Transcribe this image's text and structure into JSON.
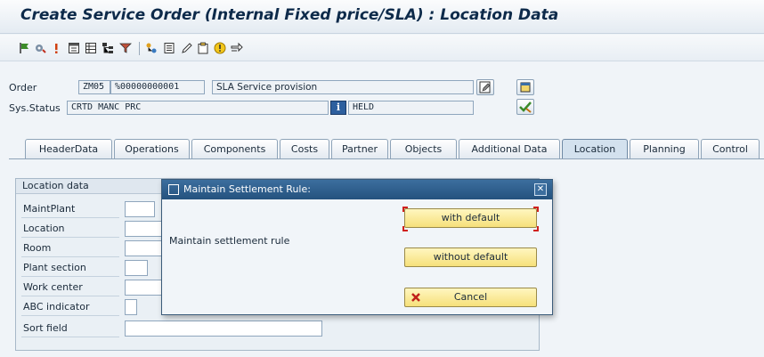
{
  "window": {
    "title": "Create Service Order (Internal Fixed price/SLA) : Location Data"
  },
  "toolbar": {
    "icons": [
      "flag-icon",
      "settings-icon",
      "alert-icon",
      "header-icon",
      "list-icon",
      "hierarchy-icon",
      "filter-icon",
      "structure-icon",
      "notes-icon",
      "pencil-icon",
      "clipboard-icon",
      "info-icon",
      "forward-icon"
    ]
  },
  "header": {
    "order_label": "Order",
    "order_type": "ZM05",
    "order_number": "%00000000001",
    "order_text": "SLA Service provision",
    "status_label": "Sys.Status",
    "system_status": "CRTD MANC PRC",
    "user_status": "HELD"
  },
  "tabs": [
    {
      "label": "HeaderData"
    },
    {
      "label": "Operations"
    },
    {
      "label": "Components"
    },
    {
      "label": "Costs"
    },
    {
      "label": "Partner"
    },
    {
      "label": "Objects"
    },
    {
      "label": "Additional Data"
    },
    {
      "label": "Location",
      "active": true
    },
    {
      "label": "Planning"
    },
    {
      "label": "Control"
    }
  ],
  "location": {
    "group_title": "Location data",
    "fields": [
      {
        "label": "MaintPlant"
      },
      {
        "label": "Location"
      },
      {
        "label": "Room"
      },
      {
        "label": "Plant section"
      },
      {
        "label": "Work center"
      },
      {
        "label": "ABC indicator"
      },
      {
        "label": "Sort field"
      }
    ]
  },
  "dialog": {
    "title": "Maintain Settlement Rule:",
    "message": "Maintain settlement rule",
    "with_default": "with default",
    "without_default": "without default",
    "cancel": "Cancel"
  },
  "colors": {
    "title_text": "#0d2a4a",
    "dialog_title_bg": "#2d5f8e",
    "button_yellow": "#f6e07a",
    "focus_red": "#d0201e"
  }
}
